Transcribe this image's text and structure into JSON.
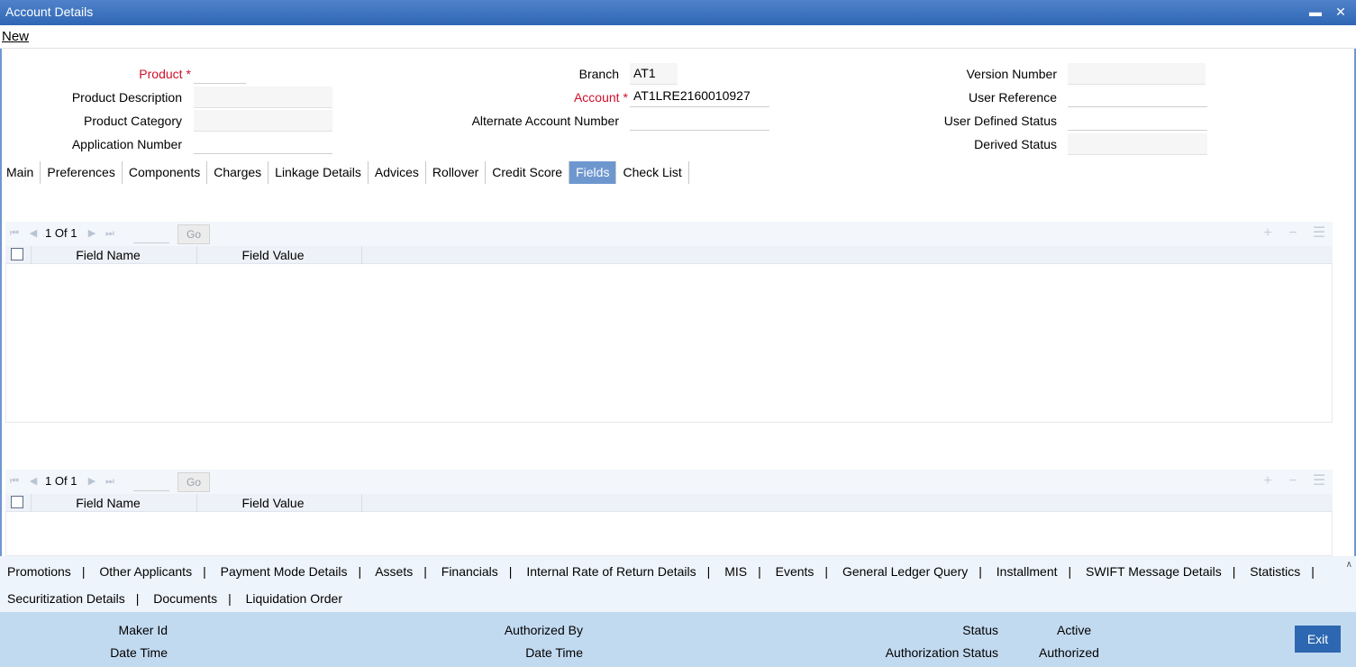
{
  "window": {
    "title": "Account Details"
  },
  "menu": {
    "new_label": "New"
  },
  "form": {
    "product_label": "Product",
    "product_value": "",
    "product_description_label": "Product Description",
    "product_description_value": "",
    "product_category_label": "Product Category",
    "product_category_value": "",
    "application_number_label": "Application Number",
    "application_number_value": "",
    "branch_label": "Branch",
    "branch_value": "AT1",
    "account_label": "Account",
    "account_value": "AT1LRE2160010927",
    "alternate_account_label": "Alternate Account Number",
    "alternate_account_value": "",
    "version_number_label": "Version Number",
    "version_number_value": "",
    "user_reference_label": "User Reference",
    "user_reference_value": "",
    "user_defined_status_label": "User Defined Status",
    "user_defined_status_value": "",
    "derived_status_label": "Derived Status",
    "derived_status_value": "",
    "required_marker": "*"
  },
  "tabs": [
    "Main",
    "Preferences",
    "Components",
    "Charges",
    "Linkage Details",
    "Advices",
    "Rollover",
    "Credit Score",
    "Fields",
    "Check List"
  ],
  "active_tab": "Fields",
  "grid1": {
    "page": "1",
    "of_label": "Of",
    "total": "1",
    "go_label": "Go",
    "col1": "Field Name",
    "col2": "Field Value"
  },
  "grid2": {
    "page": "1",
    "of_label": "Of",
    "total": "1",
    "go_label": "Go",
    "col1": "Field Name",
    "col2": "Field Value"
  },
  "links_row1": [
    "Promotions",
    "Other Applicants",
    "Payment Mode Details",
    "Assets",
    "Financials",
    "Internal Rate of Return Details",
    "MIS",
    "Events",
    "General Ledger Query",
    "Installment",
    "SWIFT Message Details",
    "Statistics"
  ],
  "links_row2": [
    "Securitization Details",
    "Documents",
    "Liquidation Order"
  ],
  "footer": {
    "maker_id_label": "Maker Id",
    "date_time_label": "Date Time",
    "authorized_by_label": "Authorized By",
    "date_time2_label": "Date Time",
    "status_label": "Status",
    "status_value": "Active",
    "auth_status_label": "Authorization Status",
    "auth_status_value": "Authorized",
    "exit_label": "Exit"
  }
}
